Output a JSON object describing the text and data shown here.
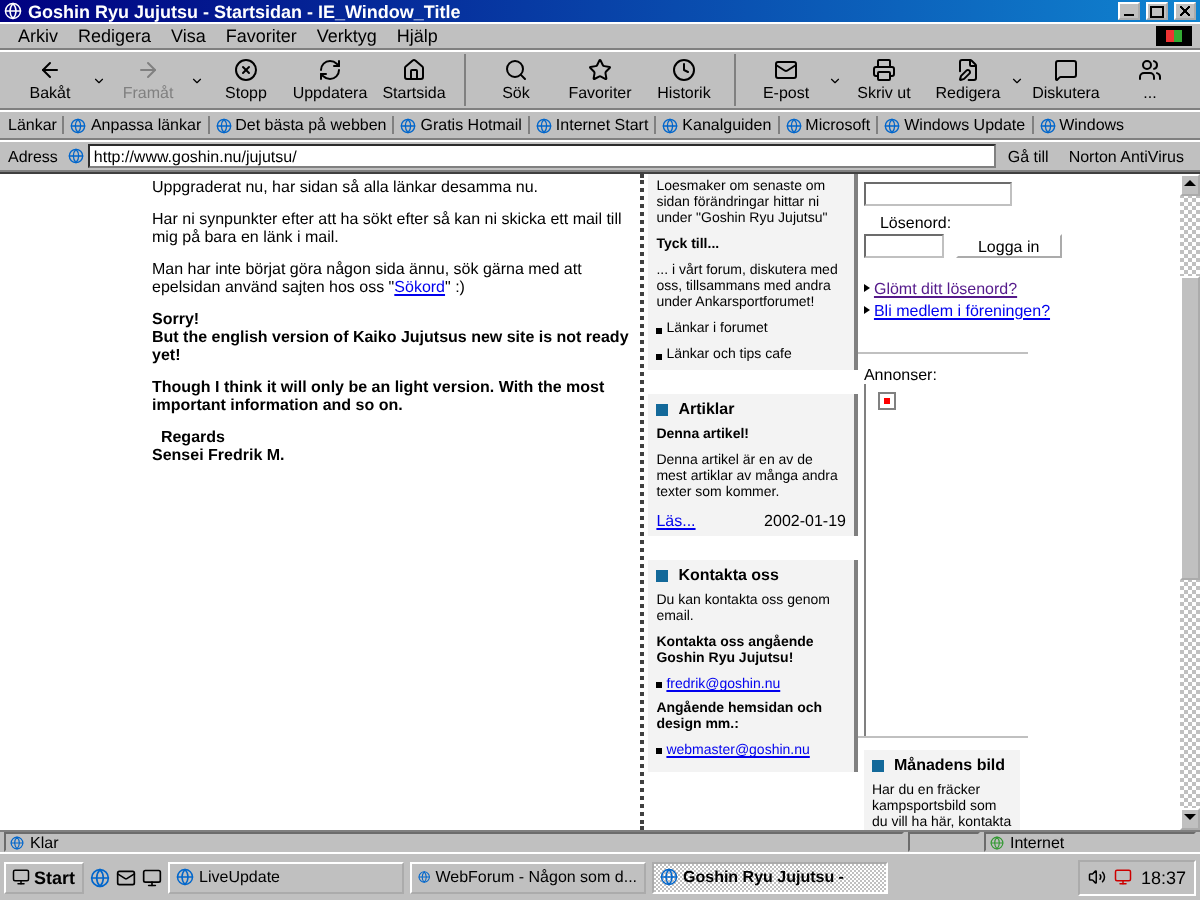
{
  "window": {
    "title": "Goshin Ryu Jujutsu - Startsidan - IE_Window_Title"
  },
  "menu": [
    "Arkiv",
    "Redigera",
    "Visa",
    "Favoriter",
    "Verktyg",
    "Hjälp"
  ],
  "toolbar": [
    [
      {
        "label": "Bakåt",
        "disabled": false,
        "has_menu": true
      },
      {
        "label": "Framåt",
        "disabled": true,
        "has_menu": true
      },
      {
        "label": "Stopp",
        "disabled": false,
        "has_menu": false
      },
      {
        "label": "Uppdatera",
        "disabled": false,
        "has_menu": false
      },
      {
        "label": "Startsida",
        "disabled": false,
        "has_menu": false
      }
    ],
    [
      {
        "label": "Sök",
        "disabled": false,
        "has_menu": false
      },
      {
        "label": "Favoriter",
        "disabled": false,
        "has_menu": false
      },
      {
        "label": "Historik",
        "disabled": false,
        "has_menu": false
      }
    ],
    [
      {
        "label": "E-post",
        "disabled": false,
        "has_menu": true
      },
      {
        "label": "Skriv ut",
        "disabled": false,
        "has_menu": false
      },
      {
        "label": "Redigera",
        "disabled": false,
        "has_menu": true
      },
      {
        "label": "Diskutera",
        "disabled": false,
        "has_menu": false
      },
      {
        "label": "...",
        "disabled": false,
        "has_menu": false
      }
    ]
  ],
  "links_bar": {
    "label": "Länkar",
    "items": [
      "Anpassa länkar",
      "Det bästa på webben",
      "Gratis Hotmail",
      "Internet Start",
      "Kanalguiden",
      "Microsoft",
      "Windows Update",
      "Windows"
    ]
  },
  "address_bar": {
    "label": "Adress",
    "url": "http://www.goshin.nu/jujutsu/",
    "go": "Gå till",
    "extra": "Norton AntiVirus"
  },
  "content": [
    {
      "kind": "text",
      "text": "Uppgraderat nu, har sidan så alla länkar desamma nu."
    },
    {
      "kind": "text",
      "text": "Har ni synpunkter efter att ha sökt efter så kan ni skicka ett mail till mig på bara en länk i mail."
    },
    {
      "kind": "link_text",
      "text": "Man har inte börjat göra någon sida ännu, sök gärna med att epelsidan använd sajten hos oss \"",
      "link": "Sökord",
      "after": "\" :)"
    },
    {
      "kind": "bold",
      "text": "Sorry!\nBut the english version of Kaiko Jujutsus new site is not ready yet!"
    },
    {
      "kind": "bold",
      "text": "Though I think it will only be an light version. With the most important information and so on."
    },
    {
      "kind": "bold",
      "text": "  Regards\nSensei Fredrik M."
    }
  ],
  "middle_panels": [
    {
      "blocks": [
        {
          "kind": "text",
          "text": "Loesmaker om senaste om sidan förändringar hittar ni under \"Goshin Ryu Jujutsu\""
        },
        {
          "kind": "bold",
          "text": "Tyck till..."
        },
        {
          "kind": "text",
          "text": "... i vårt forum, diskutera med oss, tillsammans med andra under Ankarsportforumet!"
        },
        {
          "kind": "bullet",
          "text": "Länkar i forumet"
        },
        {
          "kind": "bullet",
          "text": "Länkar och tips cafe"
        }
      ]
    },
    {
      "header": "Artiklar",
      "blocks": [
        {
          "kind": "bold",
          "text": "Denna artikel!"
        },
        {
          "kind": "text",
          "text": "Denna artikel är en av de mest artiklar av många andra texter som kommer."
        },
        {
          "kind": "footer",
          "link": "Läs...",
          "text": "2002-01-19"
        }
      ]
    },
    {
      "header": "Kontakta oss",
      "blocks": [
        {
          "kind": "text",
          "text": "Du kan kontakta oss genom email."
        },
        {
          "kind": "bold",
          "text": "Kontakta oss angående Goshin Ryu Jujutsu!"
        },
        {
          "kind": "bullet_link",
          "text": "fredrik@goshin.nu"
        },
        {
          "kind": "bold",
          "text": "Angående hemsidan och design mm.:"
        },
        {
          "kind": "bullet_link",
          "text": "webmaster@goshin.nu"
        }
      ]
    }
  ],
  "login": {
    "password_label": "Lösenord:",
    "button": "Logga in"
  },
  "right_links": [
    {
      "text": "Glömt ditt lösenord?",
      "visited": true
    },
    {
      "text": "Bli medlem i föreningen?",
      "visited": false
    }
  ],
  "ads_label": "Annonser:",
  "month_panel": {
    "header": "Månadens bild",
    "text": "Har du en fräcker kampsportsbild som du vill ha här, kontakta"
  },
  "status_bar": {
    "text": "Klar",
    "zone": "Internet"
  },
  "taskbar": {
    "start": "Start",
    "tasks": [
      {
        "label": "LiveUpdate",
        "selected": false
      },
      {
        "label": "WebForum - Någon som d...",
        "selected": false
      },
      {
        "label": "Goshin Ryu Jujutsu -",
        "selected": true
      }
    ],
    "clock": "18:37"
  }
}
